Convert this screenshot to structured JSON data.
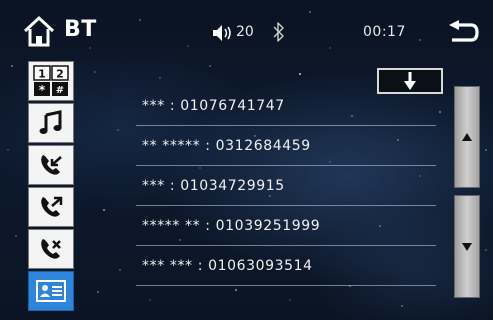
{
  "header": {
    "title": "BT",
    "volume": "20",
    "time": "00:17",
    "icons": [
      "home-icon",
      "volume-icon",
      "bluetooth-icon",
      "back-icon"
    ]
  },
  "sidebar": {
    "items": [
      {
        "name": "dialpad",
        "icon": "dialpad-icon",
        "keys": [
          "1",
          "2",
          "*",
          "#"
        ],
        "active": false
      },
      {
        "name": "music",
        "icon": "music-note-icon",
        "active": false
      },
      {
        "name": "incoming-calls",
        "icon": "incoming-call-icon",
        "active": false
      },
      {
        "name": "outgoing-calls",
        "icon": "outgoing-call-icon",
        "active": false
      },
      {
        "name": "missed-calls",
        "icon": "missed-call-icon",
        "active": false
      },
      {
        "name": "contacts",
        "icon": "contact-card-icon",
        "active": true
      }
    ]
  },
  "contacts": [
    "*** : 01076741747",
    "** ***** : 0312684459",
    "*** : 01034729915",
    "***** ** : 01039251999",
    "*** *** : 01063093514"
  ],
  "controls": {
    "download_icon": "download-arrow-icon",
    "scroll_up_icon": "triangle-up-icon",
    "scroll_down_icon": "triangle-down-icon"
  },
  "colors": {
    "accent": "#2d86d9",
    "sidebar_bg": "#f4f4f4",
    "background": "#0d1a2e",
    "scroll_button": "#bfbfbf"
  }
}
